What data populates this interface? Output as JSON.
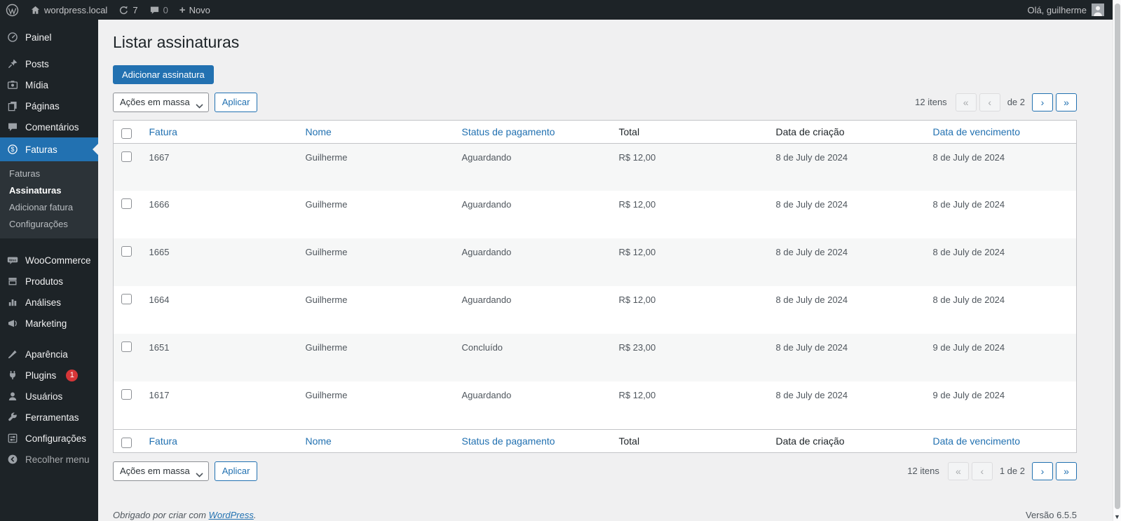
{
  "colors": {
    "accent": "#2271b1",
    "admin_bar_bg": "#1d2327",
    "menu_active_bg": "#2271b1",
    "badge_red": "#d63638",
    "row_stripe": "#f6f7f7",
    "content_bg": "#f0f0f1"
  },
  "admin_bar": {
    "site_name": "wordpress.local",
    "updates_count": "7",
    "comments_count": "0",
    "new_label": "Novo",
    "greeting": "Olá, guilherme"
  },
  "sidebar": {
    "items": [
      {
        "label": "Painel"
      },
      {
        "label": "Posts"
      },
      {
        "label": "Mídia"
      },
      {
        "label": "Páginas"
      },
      {
        "label": "Comentários"
      },
      {
        "label": "Faturas"
      },
      {
        "label": "WooCommerce"
      },
      {
        "label": "Produtos"
      },
      {
        "label": "Análises"
      },
      {
        "label": "Marketing"
      },
      {
        "label": "Aparência"
      },
      {
        "label": "Plugins"
      },
      {
        "label": "Usuários"
      },
      {
        "label": "Ferramentas"
      },
      {
        "label": "Configurações"
      },
      {
        "label": "Recolher menu"
      }
    ],
    "plugins_badge": "1",
    "faturas_submenu": [
      {
        "label": "Faturas"
      },
      {
        "label": "Assinaturas"
      },
      {
        "label": "Adicionar fatura"
      },
      {
        "label": "Configurações"
      }
    ]
  },
  "page": {
    "title": "Listar assinaturas",
    "add_button": "Adicionar assinatura"
  },
  "bulk_actions": {
    "select_label": "Ações em massa",
    "apply_label": "Aplicar"
  },
  "pagination_top": {
    "items": "12 itens",
    "first": "«",
    "prev": "‹",
    "paging": "de 2",
    "next": "›",
    "last": "»"
  },
  "pagination_bottom": {
    "items": "12 itens",
    "first": "«",
    "prev": "‹",
    "paging": "1 de 2",
    "next": "›",
    "last": "»"
  },
  "table": {
    "headers": [
      "Fatura",
      "Nome",
      "Status de pagamento",
      "Total",
      "Data de criação",
      "Data de vencimento"
    ],
    "rows": [
      {
        "fatura": "1667",
        "nome": "Guilherme",
        "status": "Aguardando",
        "total": "R$ 12,00",
        "criacao": "8 de July de 2024",
        "vencimento": "8 de July de 2024"
      },
      {
        "fatura": "1666",
        "nome": "Guilherme",
        "status": "Aguardando",
        "total": "R$ 12,00",
        "criacao": "8 de July de 2024",
        "vencimento": "8 de July de 2024"
      },
      {
        "fatura": "1665",
        "nome": "Guilherme",
        "status": "Aguardando",
        "total": "R$ 12,00",
        "criacao": "8 de July de 2024",
        "vencimento": "8 de July de 2024"
      },
      {
        "fatura": "1664",
        "nome": "Guilherme",
        "status": "Aguardando",
        "total": "R$ 12,00",
        "criacao": "8 de July de 2024",
        "vencimento": "8 de July de 2024"
      },
      {
        "fatura": "1651",
        "nome": "Guilherme",
        "status": "Concluído",
        "total": "R$ 23,00",
        "criacao": "8 de July de 2024",
        "vencimento": "9 de July de 2024"
      },
      {
        "fatura": "1617",
        "nome": "Guilherme",
        "status": "Aguardando",
        "total": "R$ 12,00",
        "criacao": "8 de July de 2024",
        "vencimento": "9 de July de 2024"
      }
    ]
  },
  "footer": {
    "thanks_prefix": "Obrigado por criar com ",
    "thanks_link": "WordPress",
    "thanks_suffix": ".",
    "version": "Versão 6.5.5"
  }
}
